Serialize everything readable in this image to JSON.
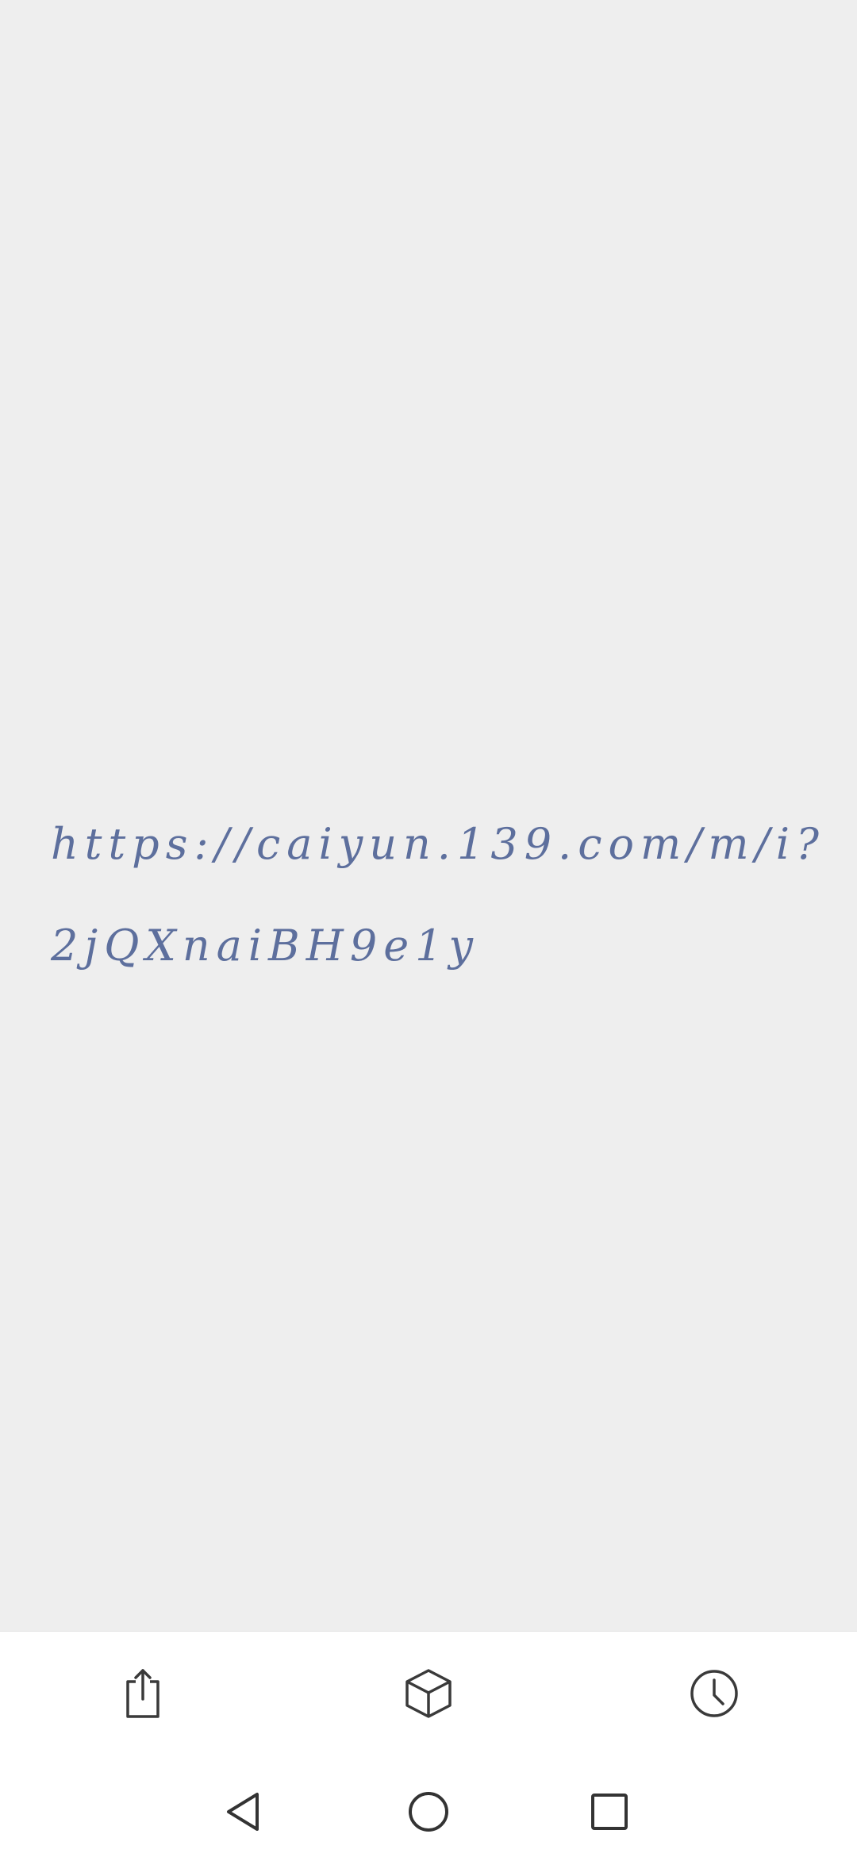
{
  "note": {
    "text": "https://caiyun.139.com/m/i?2jQXnaiBH9e1y"
  },
  "toolbar": {
    "items": [
      {
        "icon": "share-icon"
      },
      {
        "icon": "box-icon"
      },
      {
        "icon": "clock-icon"
      }
    ]
  },
  "navbar": {
    "items": [
      {
        "icon": "back-triangle-icon"
      },
      {
        "icon": "home-circle-icon"
      },
      {
        "icon": "recents-square-icon"
      }
    ]
  },
  "colors": {
    "background": "#eeeeee",
    "text": "#5d6f9d",
    "icon": "#3a3a3a"
  }
}
